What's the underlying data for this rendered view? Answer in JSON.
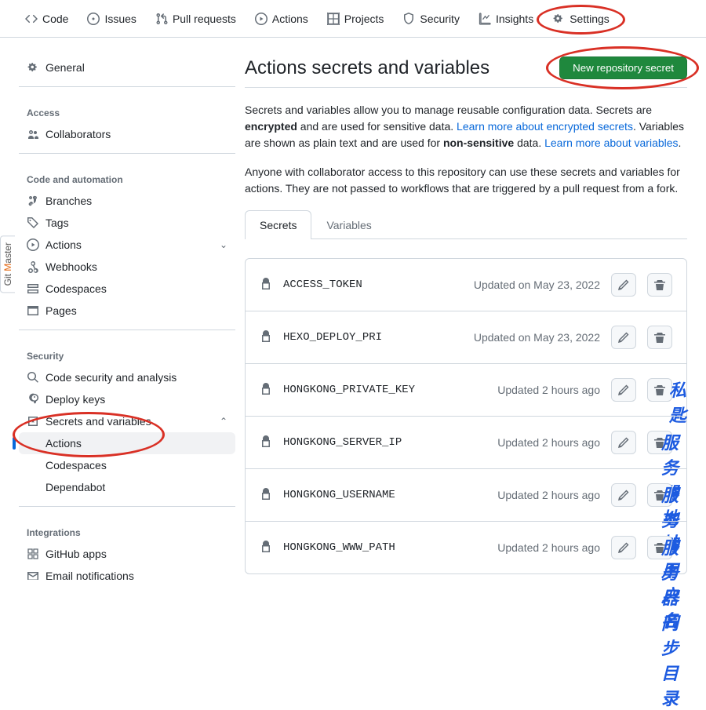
{
  "topnav": {
    "code": "Code",
    "issues": "Issues",
    "pulls": "Pull requests",
    "actions": "Actions",
    "projects": "Projects",
    "security": "Security",
    "insights": "Insights",
    "settings": "Settings"
  },
  "sidebar": {
    "general": "General",
    "access_heading": "Access",
    "collaborators": "Collaborators",
    "code_heading": "Code and automation",
    "branches": "Branches",
    "tags": "Tags",
    "actions": "Actions",
    "webhooks": "Webhooks",
    "codespaces": "Codespaces",
    "pages": "Pages",
    "security_heading": "Security",
    "code_security": "Code security and analysis",
    "deploy_keys": "Deploy keys",
    "secrets_vars": "Secrets and variables",
    "sub_actions": "Actions",
    "sub_codespaces": "Codespaces",
    "sub_dependabot": "Dependabot",
    "integrations_heading": "Integrations",
    "github_apps": "GitHub apps",
    "email_notifications": "Email notifications"
  },
  "page": {
    "title": "Actions secrets and variables",
    "new_secret": "New repository secret",
    "desc1_a": "Secrets and variables allow you to manage reusable configuration data. Secrets are ",
    "desc1_b": "encrypted",
    "desc1_c": " and are used for sensitive data. ",
    "desc1_link1": "Learn more about encrypted secrets",
    "desc1_d": ". Variables are shown as plain text and are used for ",
    "desc1_e": "non-sensitive",
    "desc1_f": " data. ",
    "desc1_link2": "Learn more about variables",
    "desc1_g": ".",
    "desc2": "Anyone with collaborator access to this repository can use these secrets and variables for actions. They are not passed to workflows that are triggered by a pull request from a fork."
  },
  "tabs": {
    "secrets": "Secrets",
    "variables": "Variables"
  },
  "secrets": [
    {
      "name": "ACCESS_TOKEN",
      "updated": "Updated on May 23, 2022",
      "annotation": ""
    },
    {
      "name": "HEXO_DEPLOY_PRI",
      "updated": "Updated on May 23, 2022",
      "annotation": ""
    },
    {
      "name": "HONGKONG_PRIVATE_KEY",
      "updated": "Updated 2 hours ago",
      "annotation": "私匙"
    },
    {
      "name": "HONGKONG_SERVER_IP",
      "updated": "Updated 2 hours ago",
      "annotation": "服务器地址"
    },
    {
      "name": "HONGKONG_USERNAME",
      "updated": "Updated 2 hours ago",
      "annotation": "服务器用户名"
    },
    {
      "name": "HONGKONG_WWW_PATH",
      "updated": "Updated 2 hours ago",
      "annotation": "服务器同步目录"
    }
  ],
  "gitmaster": "Git Master"
}
